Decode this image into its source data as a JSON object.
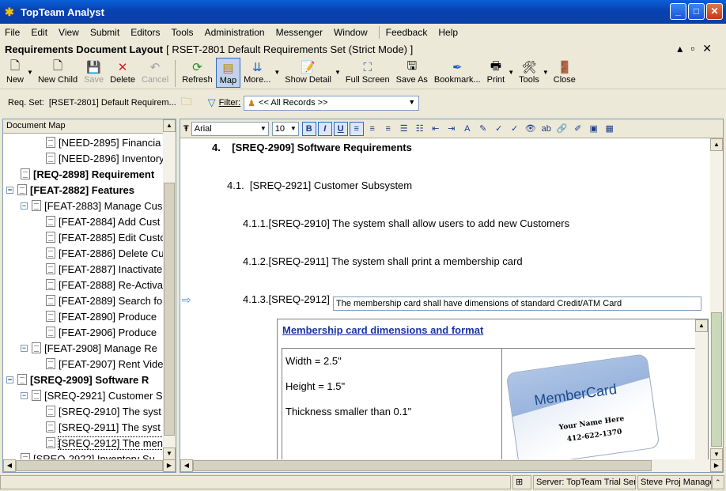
{
  "window": {
    "title": "TopTeam Analyst"
  },
  "menu": [
    "File",
    "Edit",
    "View",
    "Submit",
    "Editors",
    "Tools",
    "Administration",
    "Messenger",
    "Window",
    "Feedback",
    "Help"
  ],
  "document": {
    "type_label": "Requirements Document Layout",
    "set_label": "[ RSET-2801 Default Requirements Set (Strict Mode) ]"
  },
  "toolbar": {
    "new": "New",
    "new_child": "New Child",
    "save": "Save",
    "delete": "Delete",
    "cancel": "Cancel",
    "refresh": "Refresh",
    "map": "Map",
    "more": "More...",
    "show_detail": "Show Detail",
    "full_screen": "Full Screen",
    "save_as": "Save As",
    "bookmark": "Bookmark...",
    "print": "Print",
    "tools": "Tools",
    "close": "Close"
  },
  "reqset": {
    "label": "Req. Set:",
    "value": "[RSET-2801] Default Requirem...",
    "filter_label": "Filter:",
    "filter_value": "<< All Records >>"
  },
  "docmap": {
    "header": "Document Map",
    "items": [
      {
        "text": "[NEED-2895] Financia",
        "level": 3
      },
      {
        "text": "[NEED-2896] Inventory",
        "level": 3
      },
      {
        "text": "[REQ-2898] Requirement",
        "level": 1,
        "bold": true
      },
      {
        "text": "[FEAT-2882] Features",
        "level": 0,
        "bold": true,
        "expand": "−"
      },
      {
        "text": "[FEAT-2883] Manage Cus",
        "level": 1,
        "expand": "−"
      },
      {
        "text": "[FEAT-2884] Add  Cust",
        "level": 3
      },
      {
        "text": "[FEAT-2885] Edit Custo",
        "level": 3
      },
      {
        "text": "[FEAT-2886] Delete Cu",
        "level": 3
      },
      {
        "text": "[FEAT-2887] Inactivate",
        "level": 3
      },
      {
        "text": "[FEAT-2888] Re-Activa",
        "level": 3
      },
      {
        "text": "[FEAT-2889] Search fo",
        "level": 3
      },
      {
        "text": "[FEAT-2890] Produce",
        "level": 3
      },
      {
        "text": "[FEAT-2906] Produce",
        "level": 3
      },
      {
        "text": "[FEAT-2908] Manage Re",
        "level": 1,
        "expand": "−"
      },
      {
        "text": "[FEAT-2907] Rent Vide",
        "level": 3
      },
      {
        "text": "[SREQ-2909] Software R",
        "level": 0,
        "bold": true,
        "expand": "−"
      },
      {
        "text": "[SREQ-2921] Customer S",
        "level": 1,
        "expand": "−"
      },
      {
        "text": "[SREQ-2910] The syst",
        "level": 3
      },
      {
        "text": "[SREQ-2911] The syst",
        "level": 3
      },
      {
        "text": "[SREQ-2912] The men",
        "level": 3,
        "selected": true
      },
      {
        "text": "[SREQ-2922] Inventory Su",
        "level": 1
      }
    ]
  },
  "format": {
    "font": "Arial",
    "size": "10"
  },
  "doc_content": {
    "section_num": "4.",
    "section_title": "[SREQ-2909] Software Requirements",
    "sub_num": "4.1.",
    "sub_title": "[SREQ-2921] Customer Subsystem",
    "r1_num": "4.1.1.",
    "r1_text": "[SREQ-2910] The system shall allow users to add new Customers",
    "r2_num": "4.1.2.",
    "r2_text": "[SREQ-2911] The system shall print a membership card",
    "r3_num": "4.1.3.",
    "r3_id": "[SREQ-2912]",
    "r3_edit": "The membership card shall have dimensions of standard Credit/ATM Card",
    "card_title": "Membership card dimensions and format",
    "width": "Width = 2.5\"",
    "height": "Height = 1.5\"",
    "thickness": "Thickness smaller than 0.1\"",
    "card_brand": "MemberCard",
    "card_name": "Your Name Here",
    "card_phone": "412-622-1370"
  },
  "status": {
    "server": "Server: TopTeam Trial Ser",
    "project": "Steve Proj Manage"
  }
}
